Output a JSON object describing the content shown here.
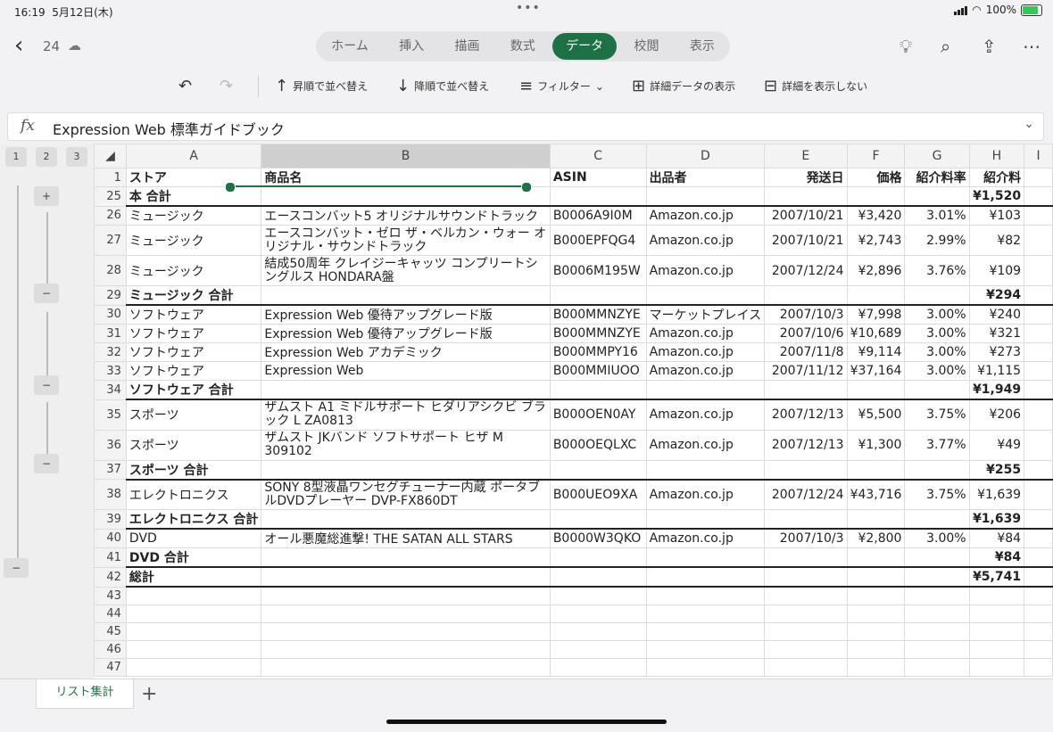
{
  "status": {
    "time": "16:19",
    "date": "5月12日(木)",
    "battery": "100%"
  },
  "nav": {
    "page_count": "24",
    "tabs": [
      {
        "label": "ホーム"
      },
      {
        "label": "挿入"
      },
      {
        "label": "描画"
      },
      {
        "label": "数式"
      },
      {
        "label": "データ",
        "active": true
      },
      {
        "label": "校閲"
      },
      {
        "label": "表示"
      }
    ]
  },
  "ribbon": {
    "sort_asc": "昇順で並べ替え",
    "sort_desc": "降順で並べ替え",
    "filter": "フィルター",
    "show_detail": "詳細データの表示",
    "hide_detail": "詳細を表示しない"
  },
  "formula": {
    "value": "Expression Web 標準ガイドブック"
  },
  "outline_levels": [
    "1",
    "2",
    "3"
  ],
  "columns": [
    "A",
    "B",
    "C",
    "D",
    "E",
    "F",
    "G",
    "H",
    "I"
  ],
  "rows": [
    {
      "n": "1",
      "c": [
        "ストア",
        "商品名",
        "ASIN",
        "出品者",
        "発送日",
        "価格",
        "紹介料率",
        "紹介料"
      ],
      "bold": true
    },
    {
      "n": "25",
      "c": [
        "本 合計",
        "",
        "",
        "",
        "",
        "",
        "",
        "¥1,520"
      ],
      "total": true
    },
    {
      "n": "26",
      "c": [
        "ミュージック",
        "エースコンバット5 オリジナルサウンドトラック",
        "B0006A9I0M",
        "Amazon.co.jp",
        "2007/10/21",
        "¥3,420",
        "3.01%",
        "¥103"
      ]
    },
    {
      "n": "27",
      "c": [
        "ミュージック",
        "エースコンバット・ゼロ ザ・ベルカン・ウォー オリジナル・サウンドトラック",
        "B000EPFQG4",
        "Amazon.co.jp",
        "2007/10/21",
        "¥2,743",
        "2.99%",
        "¥82"
      ],
      "tall": true
    },
    {
      "n": "28",
      "c": [
        "ミュージック",
        "結成50周年 クレイジーキャッツ コンプリートシングルス HONDARA盤",
        "B0006M195W",
        "Amazon.co.jp",
        "2007/12/24",
        "¥2,896",
        "3.76%",
        "¥109"
      ],
      "tall": true
    },
    {
      "n": "29",
      "c": [
        "ミュージック 合計",
        "",
        "",
        "",
        "",
        "",
        "",
        "¥294"
      ],
      "total": true
    },
    {
      "n": "30",
      "c": [
        "ソフトウェア",
        "Expression Web 優待アップグレード版",
        "B000MMNZYE",
        "マーケットプレイス",
        "2007/10/3",
        "¥7,998",
        "3.00%",
        "¥240"
      ]
    },
    {
      "n": "31",
      "c": [
        "ソフトウェア",
        "Expression Web 優待アップグレード版",
        "B000MMNZYE",
        "Amazon.co.jp",
        "2007/10/6",
        "¥10,689",
        "3.00%",
        "¥321"
      ]
    },
    {
      "n": "32",
      "c": [
        "ソフトウェア",
        "Expression Web アカデミック",
        "B000MMPY16",
        "Amazon.co.jp",
        "2007/11/8",
        "¥9,114",
        "3.00%",
        "¥273"
      ]
    },
    {
      "n": "33",
      "c": [
        "ソフトウェア",
        "Expression Web",
        "B000MMIUOO",
        "Amazon.co.jp",
        "2007/11/12",
        "¥37,164",
        "3.00%",
        "¥1,115"
      ]
    },
    {
      "n": "34",
      "c": [
        "ソフトウェア 合計",
        "",
        "",
        "",
        "",
        "",
        "",
        "¥1,949"
      ],
      "total": true
    },
    {
      "n": "35",
      "c": [
        "スポーツ",
        "ザムスト A1 ミドルサポート ヒダリアシクビ ブラック L ZA0813",
        "B000OEN0AY",
        "Amazon.co.jp",
        "2007/12/13",
        "¥5,500",
        "3.75%",
        "¥206"
      ],
      "tall": true
    },
    {
      "n": "36",
      "c": [
        "スポーツ",
        "ザムスト JKバンド ソフトサポート ヒザ M 309102",
        "B000OEQLXC",
        "Amazon.co.jp",
        "2007/12/13",
        "¥1,300",
        "3.77%",
        "¥49"
      ],
      "tall": true
    },
    {
      "n": "37",
      "c": [
        "スポーツ 合計",
        "",
        "",
        "",
        "",
        "",
        "",
        "¥255"
      ],
      "total": true
    },
    {
      "n": "38",
      "c": [
        "エレクトロニクス",
        "SONY 8型液晶ワンセグチューナー内蔵 ポータブルDVDプレーヤー DVP-FX860DT",
        "B000UEO9XA",
        "Amazon.co.jp",
        "2007/12/24",
        "¥43,716",
        "3.75%",
        "¥1,639"
      ],
      "tall": true
    },
    {
      "n": "39",
      "c": [
        "エレクトロニクス 合計",
        "",
        "",
        "",
        "",
        "",
        "",
        "¥1,639"
      ],
      "total": true
    },
    {
      "n": "40",
      "c": [
        "DVD",
        "オール悪魔総進撃! THE SATAN ALL STARS",
        "B0000W3QKO",
        "Amazon.co.jp",
        "2007/10/3",
        "¥2,800",
        "3.00%",
        "¥84"
      ]
    },
    {
      "n": "41",
      "c": [
        "DVD 合計",
        "",
        "",
        "",
        "",
        "",
        "",
        "¥84"
      ],
      "total": true
    },
    {
      "n": "42",
      "c": [
        "総計",
        "",
        "",
        "",
        "",
        "",
        "",
        "¥5,741"
      ],
      "total": true
    },
    {
      "n": "43",
      "c": [
        "",
        "",
        "",
        "",
        "",
        "",
        "",
        ""
      ]
    },
    {
      "n": "44",
      "c": [
        "",
        "",
        "",
        "",
        "",
        "",
        "",
        ""
      ]
    },
    {
      "n": "45",
      "c": [
        "",
        "",
        "",
        "",
        "",
        "",
        "",
        ""
      ]
    },
    {
      "n": "46",
      "c": [
        "",
        "",
        "",
        "",
        "",
        "",
        "",
        ""
      ]
    },
    {
      "n": "47",
      "c": [
        "",
        "",
        "",
        "",
        "",
        "",
        "",
        ""
      ]
    }
  ],
  "sheet_tab": "リスト集計",
  "outline_buttons": [
    "+",
    "−",
    "−",
    "−",
    "−"
  ]
}
